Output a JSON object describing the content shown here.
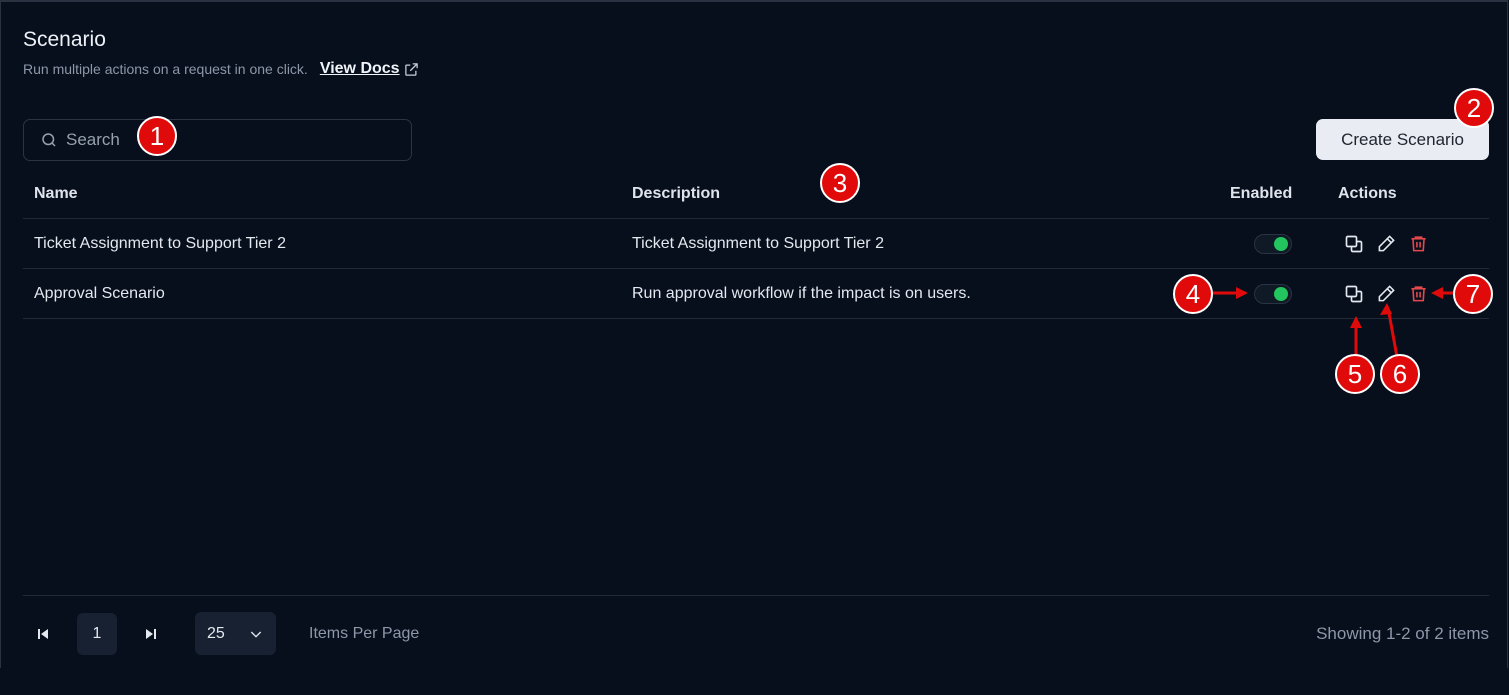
{
  "header": {
    "title": "Scenario",
    "subtitle": "Run multiple actions on a request in one click.",
    "docs_link": "View Docs"
  },
  "search": {
    "placeholder": "Search"
  },
  "create_button": "Create Scenario",
  "table": {
    "columns": {
      "name": "Name",
      "description": "Description",
      "enabled": "Enabled",
      "actions": "Actions"
    },
    "rows": [
      {
        "name": "Ticket Assignment to Support Tier 2",
        "description": "Ticket Assignment to Support Tier 2",
        "enabled": true
      },
      {
        "name": "Approval Scenario",
        "description": "Run approval workflow if the impact is on users.",
        "enabled": true
      }
    ]
  },
  "pagination": {
    "current_page": "1",
    "per_page": "25",
    "per_page_label": "Items Per Page",
    "showing": "Showing 1-2 of 2 items"
  },
  "annotations": [
    "1",
    "2",
    "3",
    "4",
    "5",
    "6",
    "7"
  ],
  "colors": {
    "accent_green": "#22c55e",
    "delete_red": "#e5484d",
    "marker_red": "#e00a0a"
  }
}
